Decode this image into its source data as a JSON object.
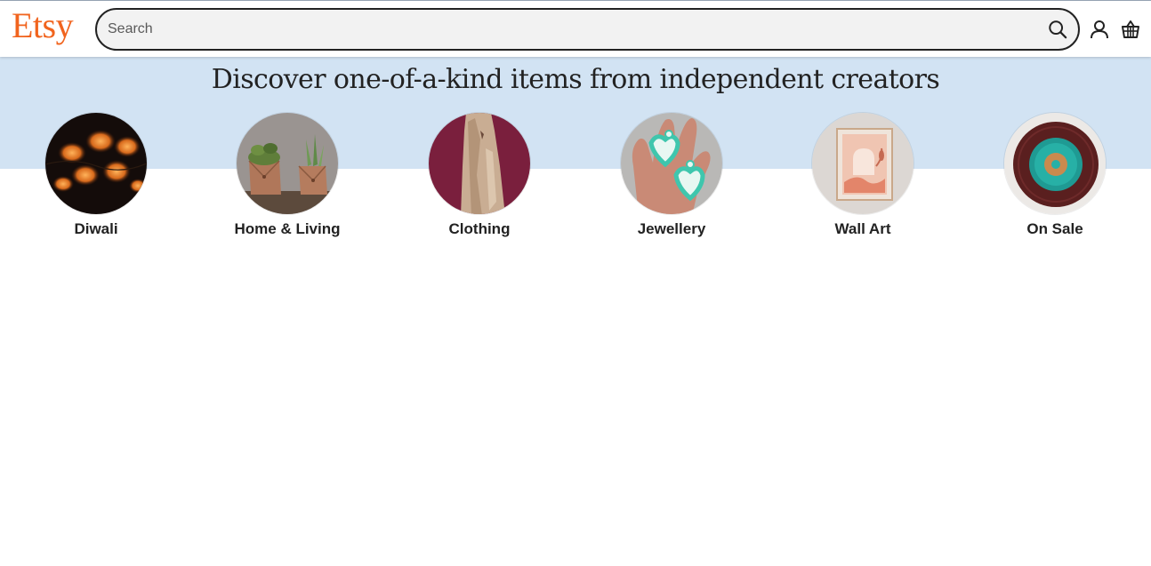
{
  "header": {
    "logo_text": "Etsy",
    "search": {
      "placeholder": "Search",
      "value": ""
    },
    "icons": {
      "search": "search-icon",
      "account": "user-icon",
      "cart": "shopping-basket-icon"
    }
  },
  "hero": {
    "title": "Discover one-of-a-kind items from independent creators"
  },
  "categories": [
    {
      "label": "Diwali",
      "image": "string-lights-photo"
    },
    {
      "label": "Home & Living",
      "image": "potted-plants-photo"
    },
    {
      "label": "Clothing",
      "image": "saree-photo"
    },
    {
      "label": "Jewellery",
      "image": "heart-earrings-photo"
    },
    {
      "label": "Wall Art",
      "image": "framed-print-photo"
    },
    {
      "label": "On Sale",
      "image": "plate-placemat-photo"
    }
  ],
  "colors": {
    "brand": "#f1641e",
    "hero_background": "#d2e3f3",
    "search_background": "#f2f2f2",
    "text": "#222222"
  }
}
